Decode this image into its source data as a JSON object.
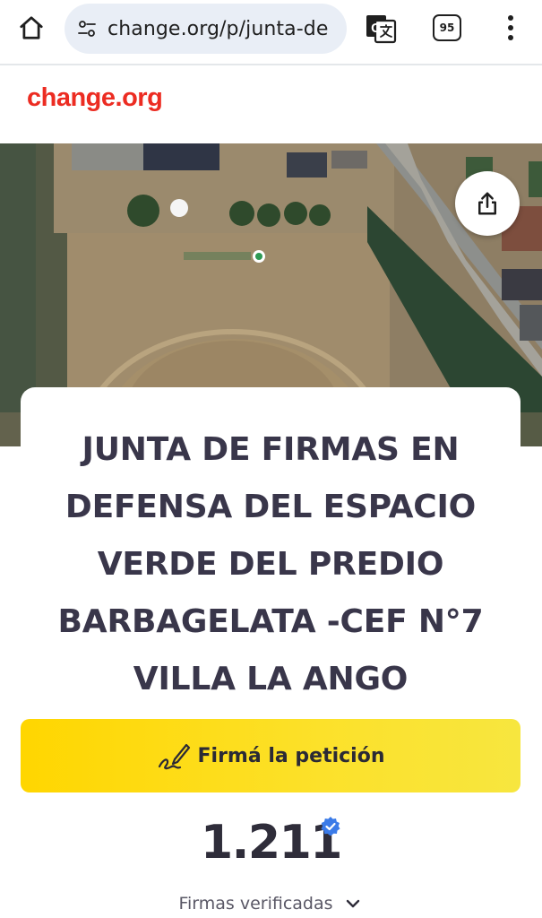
{
  "browser": {
    "url": "change.org/p/junta-de",
    "tab_count": "95",
    "icons": [
      "home-icon",
      "site-settings-icon",
      "translate-icon",
      "tabs-icon",
      "more-vert-icon"
    ]
  },
  "site": {
    "logo": "change.org",
    "brand_color": "#ec2c22"
  },
  "petition": {
    "title": "JUNTA DE FIRMAS EN DEFENSA DEL ESPACIO VERDE DEL PREDIO BARBAGELATA -CEF N°7 VILLA LA ANGO",
    "sign_button_label": "Firmá la petición",
    "sign_button_color": "#ffd600",
    "signature_count": "1.211",
    "verified_label": "Firmas verificadas"
  },
  "hero": {
    "description_icon": "aerial-map-image",
    "share_icon": "share-icon"
  }
}
